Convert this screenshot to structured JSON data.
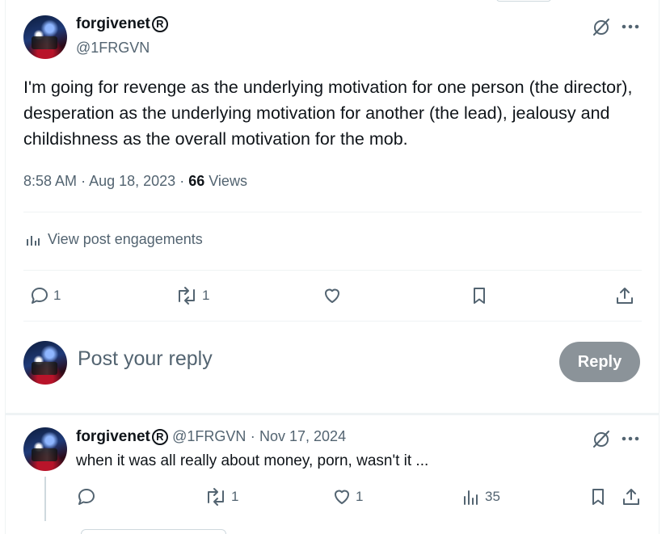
{
  "post": {
    "author_name": "forgivenet",
    "registered_mark": "R",
    "handle": "@1FRGVN",
    "text": "I'm going for revenge as the underlying motivation for one person (the director), desperation as the underlying motivation for another (the lead), jealousy and childishness as the overall motivation for the mob.",
    "time": "8:58 AM",
    "date": "Aug 18, 2023",
    "views_count": "66",
    "views_label": "Views",
    "engagements_label": "View post engagements",
    "reply_count": "1",
    "repost_count": "1"
  },
  "composer": {
    "placeholder": "Post your reply",
    "reply_button": "Reply"
  },
  "reply": {
    "author_name": "forgivenet",
    "registered_mark": "R",
    "handle": "@1FRGVN",
    "separator": "·",
    "date": "Nov 17, 2024",
    "text": "when it was all really about money, porn, wasn't it ...",
    "repost_count": "1",
    "like_count": "1",
    "views_count": "35"
  },
  "colors": {
    "text": "#0f1419",
    "muted": "#536471",
    "border": "#eff3f4",
    "reply_button_bg": "#8b9399"
  }
}
